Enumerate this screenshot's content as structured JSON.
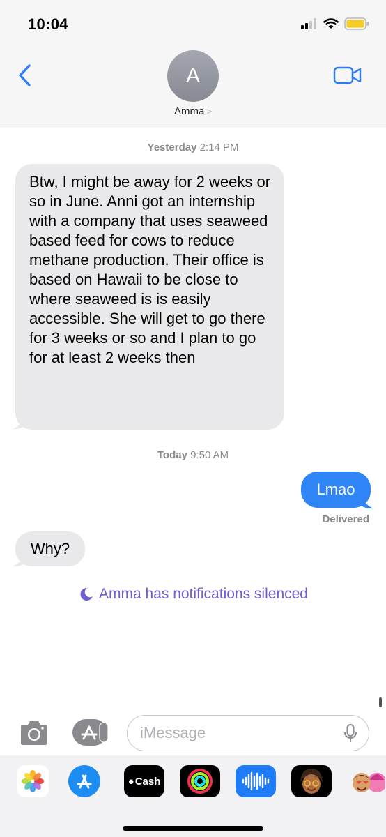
{
  "status_bar": {
    "time": "10:04"
  },
  "header": {
    "avatar_initial": "A",
    "contact_name": "Amma",
    "contact_chevron": ">"
  },
  "conversation": {
    "timestamp_1": {
      "day": "Yesterday",
      "time": "2:14 PM"
    },
    "message_1": "Btw, I might be away for 2 weeks or so in June. Anni got an internship with a company that uses seaweed based feed for cows to reduce methane production. Their office is based on Hawaii to be close to where seaweed is is easily accessible. She will get to go there for 3 weeks or so and I plan to go for at least 2 weeks then",
    "timestamp_2": {
      "day": "Today",
      "time": "9:50 AM"
    },
    "message_2": "Lmao",
    "delivered": "Delivered",
    "message_3": "Why?",
    "silenced_notice": "Amma has notifications silenced"
  },
  "input_bar": {
    "placeholder": "iMessage"
  },
  "app_drawer": {
    "cash_label": "Cash",
    "apps": [
      "photos-app",
      "app-store-app",
      "apple-cash-app",
      "activity-app",
      "audio-message-app",
      "memoji-app",
      "memoji-stickers-app"
    ]
  },
  "colors": {
    "sent_bubble": "#2f85f5",
    "received_bubble": "#e9e9eb",
    "accent": "#2f7cf6",
    "silenced_text": "#6e5fd0",
    "battery": "#f5cc27"
  }
}
